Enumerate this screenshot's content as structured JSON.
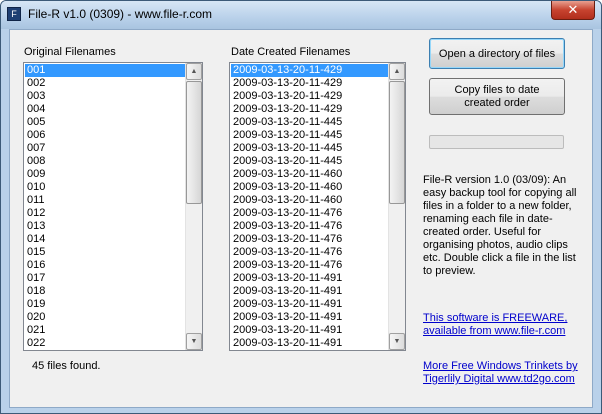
{
  "window": {
    "title": "File-R v1.0 (0309) - www.file-r.com",
    "close_glyph": "✕",
    "app_icon_glyph": "F"
  },
  "original_list": {
    "label": "Original Filenames",
    "items": [
      "001",
      "002",
      "003",
      "004",
      "005",
      "006",
      "007",
      "008",
      "009",
      "010",
      "011",
      "012",
      "013",
      "014",
      "015",
      "016",
      "017",
      "018",
      "019",
      "020",
      "021",
      "022"
    ],
    "selected_index": 0
  },
  "date_list": {
    "label": "Date Created Filenames",
    "items": [
      "2009-03-13-20-11-429",
      "2009-03-13-20-11-429",
      "2009-03-13-20-11-429",
      "2009-03-13-20-11-429",
      "2009-03-13-20-11-445",
      "2009-03-13-20-11-445",
      "2009-03-13-20-11-445",
      "2009-03-13-20-11-445",
      "2009-03-13-20-11-460",
      "2009-03-13-20-11-460",
      "2009-03-13-20-11-460",
      "2009-03-13-20-11-476",
      "2009-03-13-20-11-476",
      "2009-03-13-20-11-476",
      "2009-03-13-20-11-476",
      "2009-03-13-20-11-476",
      "2009-03-13-20-11-491",
      "2009-03-13-20-11-491",
      "2009-03-13-20-11-491",
      "2009-03-13-20-11-491",
      "2009-03-13-20-11-491",
      "2009-03-13-20-11-491"
    ],
    "selected_index": 0
  },
  "status": {
    "files_found": "45 files found."
  },
  "buttons": {
    "open_dir": "Open a directory of files",
    "copy_line1": "Copy files to date",
    "copy_line2": "created order"
  },
  "progress": {
    "value": 0
  },
  "info": {
    "description": "File-R version 1.0 (03/09): An easy backup tool for copying all files in a folder to a new folder, renaming each file in date-created order. Useful for organising photos, audio clips etc. Double click a file in the list to preview."
  },
  "links": {
    "freeware_line1": "This software is FREEWARE,",
    "freeware_line2": "available from www.file-r.com",
    "trinkets_line1": "More Free Windows Trinkets by",
    "trinkets_line2": "Tigerlily Digital www.td2go.com"
  },
  "icons": {
    "scroll_up": "▲",
    "scroll_down": "▼"
  },
  "colors": {
    "selection": "#3399ff",
    "link": "#0000cc",
    "title_bar": "#b9d1ea",
    "close_button": "#c7432f"
  }
}
